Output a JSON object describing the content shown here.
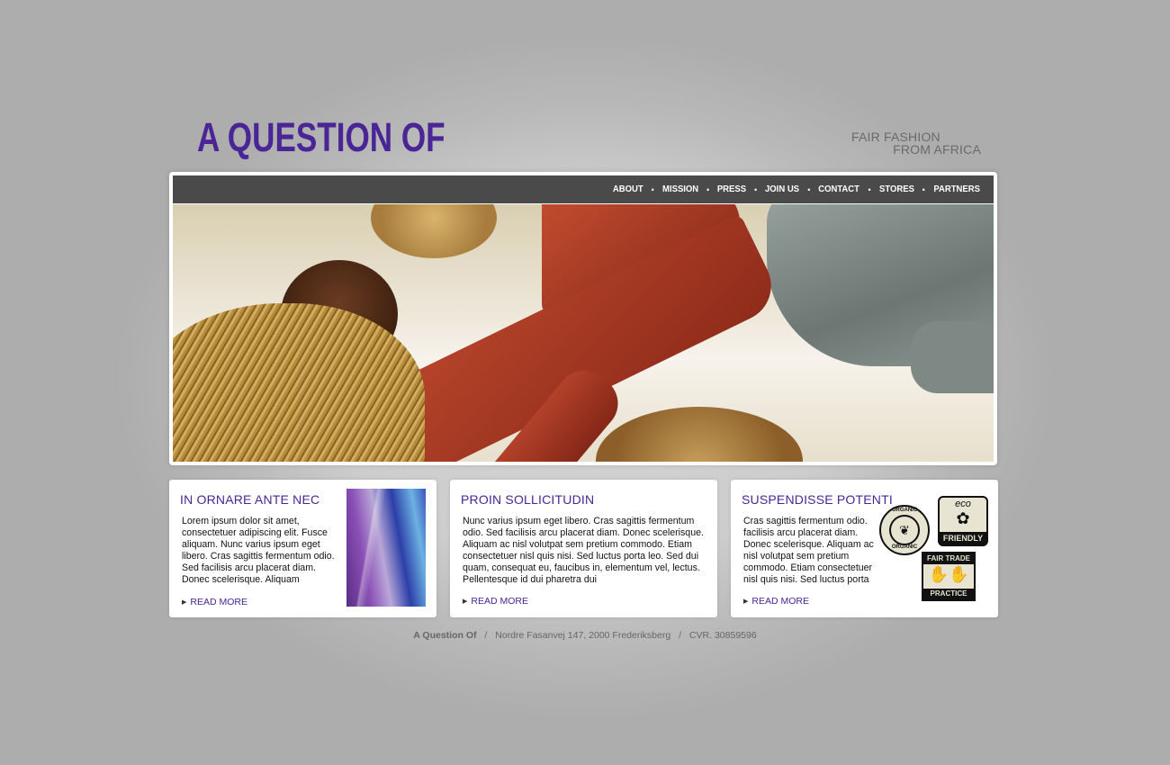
{
  "header": {
    "logo_text": "A QUESTION OF",
    "tagline_line1": "FAIR FASHION",
    "tagline_line2": "FROM AFRICA"
  },
  "nav": {
    "items": [
      "ABOUT",
      "MISSION",
      "PRESS",
      "JOIN US",
      "CONTACT",
      "STORES",
      "PARTNERS"
    ],
    "separator": "•"
  },
  "boxes": [
    {
      "title": "IN ORNARE ANTE NEC",
      "text": "Lorem ipsum dolor sit amet, consectetuer adipiscing elit. Fusce aliquam. Nunc varius ipsum eget libero. Cras sagittis fermentum odio. Sed facilisis arcu placerat diam. Donec scelerisque. Aliquam",
      "read_more": "READ MORE"
    },
    {
      "title": "PROIN SOLLICITUDIN",
      "text": "Nunc varius ipsum eget libero. Cras sagittis fermentum odio. Sed facilisis arcu placerat diam. Donec scelerisque. Aliquam ac nisl volutpat sem pretium commodo. Etiam consectetuer nisl quis nisi. Sed luctus porta leo. Sed dui quam, consequat eu, faucibus in, elementum vel, lectus. Pellentesque id dui pharetra dui",
      "read_more": "READ MORE"
    },
    {
      "title": "SUSPENDISSE POTENTI",
      "text": "Cras sagittis fermentum odio. facilisis arcu placerat diam.  Donec scelerisque. Aliquam ac nisl volutpat sem pretium commodo. Etiam consectetuer nisl quis nisi. Sed luctus porta",
      "read_more": "READ MORE"
    }
  ],
  "badges": {
    "organic": "ORGANIC",
    "eco": "eco",
    "friendly": "FRIENDLY",
    "fair_trade_top": "FAIR TRADE",
    "fair_trade_bottom": "PRACTICE"
  },
  "footer": {
    "company": "A Question Of",
    "address": "Nordre Fasanvej 147, 2000 Frederiksberg",
    "cvr": "CVR. 30859596",
    "separator": "/"
  },
  "colors": {
    "brand_purple": "#4a2596",
    "navbar_bg": "#4a4a4a"
  },
  "icons": {
    "read_more_arrow": "arrow-right-icon",
    "organic_badge": "organic-badge-icon",
    "eco_badge": "eco-friendly-badge-icon",
    "fair_trade_badge": "fair-trade-badge-icon"
  }
}
